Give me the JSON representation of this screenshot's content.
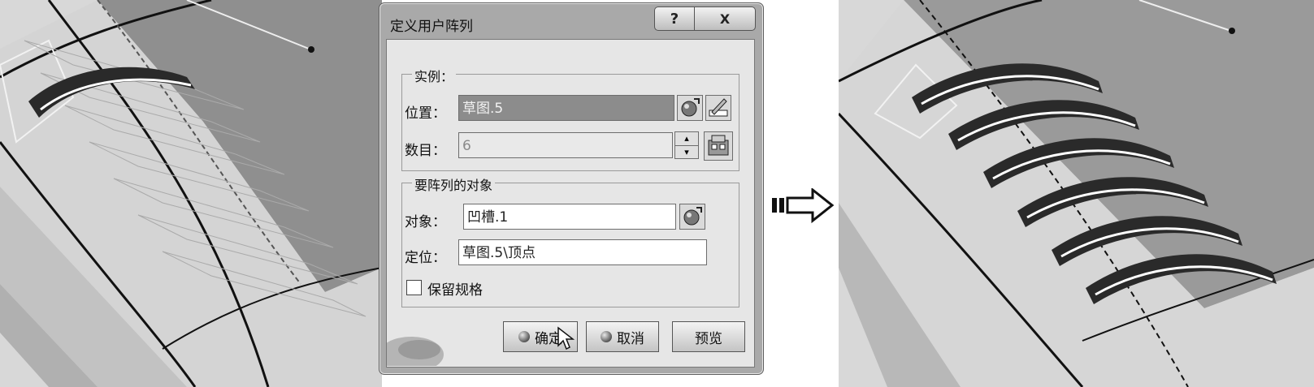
{
  "dialog": {
    "title": "定义用户阵列",
    "help_glyph": "?",
    "close_glyph": "X",
    "instances_group": {
      "label": "实例：",
      "position_label": "位置：",
      "position_value": "草图.5",
      "count_label": "数目：",
      "count_value": "6"
    },
    "object_group": {
      "label": "要阵列的对象",
      "object_label": "对象：",
      "object_value": "凹槽.1",
      "anchor_label": "定位：",
      "anchor_value": "草图.5\\顶点"
    },
    "keep_spec_label": "保留规格",
    "keep_spec_checked": false,
    "ok_label": "确定",
    "cancel_label": "取消",
    "preview_label": "预览"
  },
  "colors": {
    "dialog_frame": "#a9a9a9",
    "client_area": "#e6e6e6",
    "selected_field": "#8c8c8c",
    "model_surface": "#d8d8d8",
    "model_dark_face": "#8f8f8f"
  }
}
